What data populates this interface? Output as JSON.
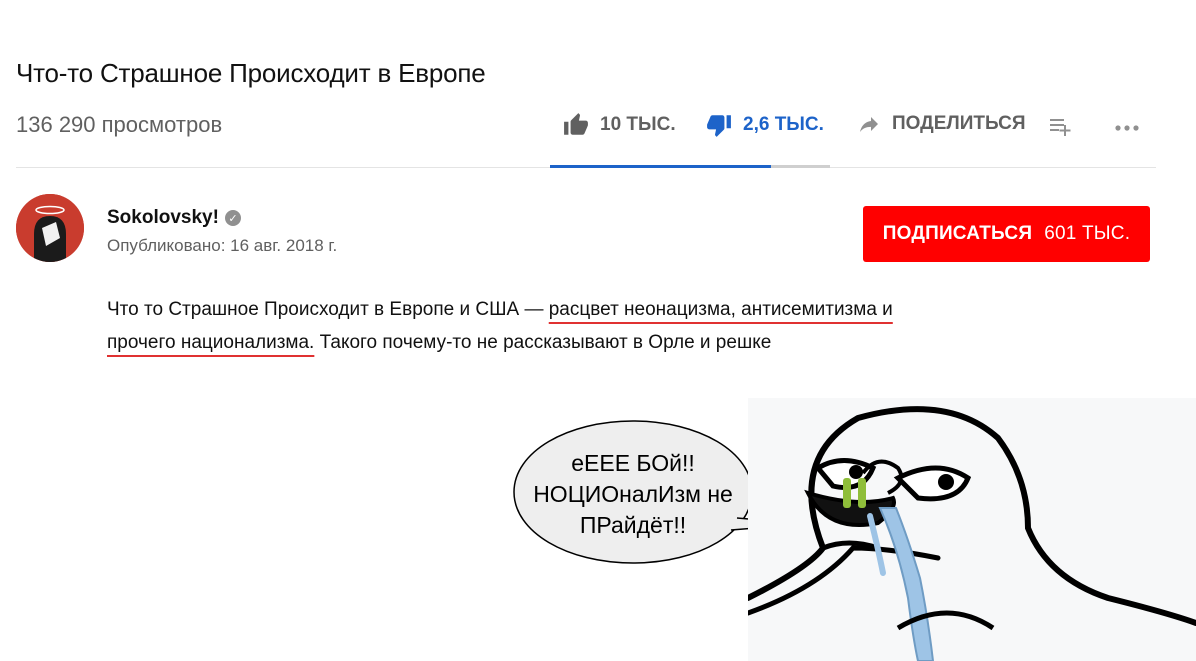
{
  "video": {
    "title": "Что-то Страшное Происходит в Европе",
    "views": "136 290 просмотров"
  },
  "actions": {
    "like_label": "10 ТЫС.",
    "dislike_label": "2,6 ТЫС.",
    "share_label": "ПОДЕЛИТЬСЯ",
    "like_share_fraction": 0.79,
    "active_color": "#1d63c9"
  },
  "channel": {
    "name": "Sokolovsky!",
    "published": "Опубликовано: 16 авг. 2018 г.",
    "subscribe_label": "ПОДПИСАТЬСЯ",
    "subscriber_count": "601 ТЫС.",
    "subscribe_color": "#ff0000"
  },
  "description": {
    "part1": "Что то Страшное Происходит в Европе и США — ",
    "highlight1": "расцвет неонацизма, антисемитизма и",
    "highlight2": "прочего национализма.",
    "part2": " Такого почему-то не рассказывают в Орле и решке"
  },
  "meme": {
    "line1": "еЕЕЕ БОй!!",
    "line2": "НОЦИОналИзм не",
    "line3": "ПРайдёт!!"
  },
  "icons": [
    "thumbs-up-icon",
    "thumbs-down-icon",
    "share-arrow-icon",
    "add-to-playlist-icon",
    "more-icon",
    "verified-icon"
  ]
}
